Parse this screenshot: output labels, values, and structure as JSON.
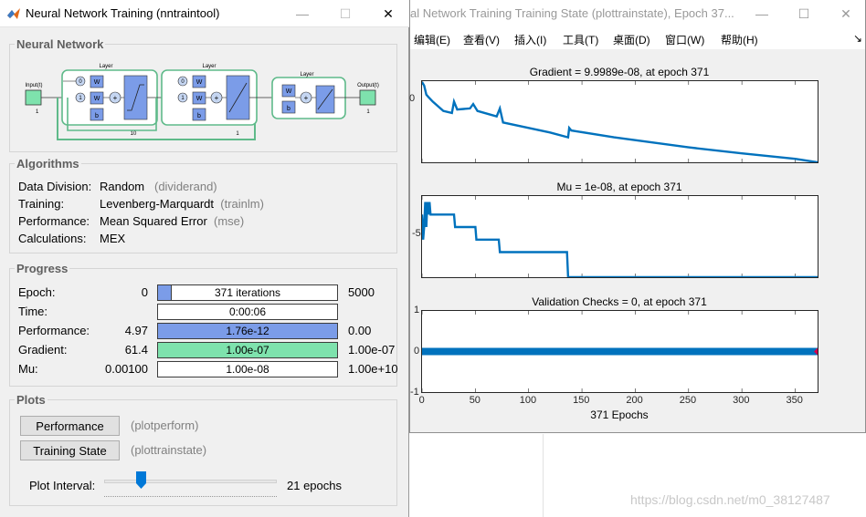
{
  "bg_window": {
    "title": "al Network Training Training State (plottrainstate), Epoch 37...",
    "minimize": "—",
    "maximize": "☐",
    "close": "✕",
    "menu": [
      "编辑(E)",
      "查看(V)",
      "插入(I)",
      "工具(T)",
      "桌面(D)",
      "窗口(W)",
      "帮助(H)"
    ],
    "menu_arrow": "↘",
    "plots": {
      "gradient_title": "Gradient = 9.9989e-08, at epoch 371",
      "gradient_ytick": "0",
      "mu_title": "Mu = 1e-08, at epoch 371",
      "mu_ytick": "-5",
      "val_title": "Validation Checks = 0, at epoch 371",
      "val_yticks": [
        "1",
        "0",
        "-1"
      ],
      "xticks": [
        "0",
        "50",
        "100",
        "150",
        "200",
        "250",
        "300",
        "350"
      ],
      "xlabel": "371 Epochs",
      "line_color": "#0072bd",
      "marker_color": "#d9004c"
    }
  },
  "chart_data": [
    {
      "type": "line",
      "title": "Gradient = 9.9989e-08, at epoch 371",
      "xlabel": "",
      "ylabel": "",
      "yscale": "log",
      "xlim": [
        0,
        371
      ],
      "x": [
        0,
        2,
        4,
        6,
        10,
        20,
        28,
        30,
        33,
        45,
        48,
        52,
        70,
        73,
        76,
        100,
        120,
        137,
        138,
        140,
        180,
        250,
        300,
        350,
        371
      ],
      "y": [
        1,
        0.5,
        0.08,
        0.05,
        0.02,
        0.003,
        0.002,
        0.02,
        0.004,
        0.005,
        0.012,
        0.003,
        0.001,
        0.005,
        0.0003,
        0.0001,
        4e-05,
        1.5e-05,
        0.0001,
        6e-05,
        1.5e-05,
        2e-06,
        6e-07,
        2e-07,
        1e-07
      ]
    },
    {
      "type": "line",
      "title": "Mu = 1e-08, at epoch 371",
      "xlabel": "",
      "ylabel": "",
      "yscale": "log",
      "xlim": [
        0,
        371
      ],
      "x": [
        0,
        1,
        2,
        3,
        4,
        5,
        6,
        7,
        8,
        10,
        30,
        31,
        50,
        51,
        72,
        73,
        136,
        137,
        371
      ],
      "y": [
        0.001,
        1e-05,
        0.0001,
        0.01,
        0.0001,
        0.01,
        0.001,
        0.01,
        0.001,
        0.001,
        0.001,
        0.0001,
        0.0001,
        1e-05,
        1e-05,
        1e-06,
        1e-06,
        1e-08,
        1e-08
      ]
    },
    {
      "type": "scatter",
      "title": "Validation Checks = 0, at epoch 371",
      "xlabel": "371 Epochs",
      "ylabel": "",
      "xlim": [
        0,
        371
      ],
      "ylim": [
        -1,
        1
      ],
      "note_values": "validation checks = 0 at every epoch 0..371",
      "y_constant": 0,
      "last_point": [
        371,
        0
      ]
    }
  ],
  "fg_window": {
    "title": "Neural Network Training (nntraintool)",
    "minimize": "—",
    "maximize": "☐",
    "close": "✕",
    "neural_network": {
      "heading": "Neural Network",
      "input_label": "Input(t)",
      "input_count": "1",
      "output_label": "Output(t)",
      "output_count": "1",
      "layer_label": "Layer",
      "layer_sizes": [
        "10",
        "1",
        ""
      ],
      "delay_labels": [
        "0",
        "1"
      ],
      "w_label": "W",
      "b_label": "b",
      "plus_label": "+"
    },
    "algorithms": {
      "heading": "Algorithms",
      "rows": [
        {
          "label": "Data Division:",
          "value": "Random",
          "fn": "(dividerand)"
        },
        {
          "label": "Training:",
          "value": "Levenberg-Marquardt",
          "fn": "(trainlm)"
        },
        {
          "label": "Performance:",
          "value": "Mean Squared Error",
          "fn": "(mse)"
        },
        {
          "label": "Calculations:",
          "value": "MEX",
          "fn": ""
        }
      ]
    },
    "progress": {
      "heading": "Progress",
      "rows": [
        {
          "label": "Epoch:",
          "min": "0",
          "bar_text": "371 iterations",
          "max": "5000",
          "fill": 0.074,
          "color": "#7b9ce8"
        },
        {
          "label": "Time:",
          "min": "",
          "bar_text": "0:00:06",
          "max": "",
          "fill": 0,
          "color": "#7b9ce8"
        },
        {
          "label": "Performance:",
          "min": "4.97",
          "bar_text": "1.76e-12",
          "max": "0.00",
          "fill": 1.0,
          "color": "#7b9ce8"
        },
        {
          "label": "Gradient:",
          "min": "61.4",
          "bar_text": "1.00e-07",
          "max": "1.00e-07",
          "fill": 1.0,
          "color": "#7ee2ad"
        },
        {
          "label": "Mu:",
          "min": "0.00100",
          "bar_text": "1.00e-08",
          "max": "1.00e+10",
          "fill": 0,
          "color": "#7b9ce8"
        }
      ]
    },
    "plots": {
      "heading": "Plots",
      "buttons": [
        {
          "label": "Performance",
          "fn": "(plotperform)"
        },
        {
          "label": "Training State",
          "fn": "(plottrainstate)"
        }
      ],
      "interval_label": "Plot Interval:",
      "interval_value": "21 epochs",
      "slider_fraction": 0.21
    }
  },
  "watermark": "https://blog.csdn.net/m0_38127487"
}
